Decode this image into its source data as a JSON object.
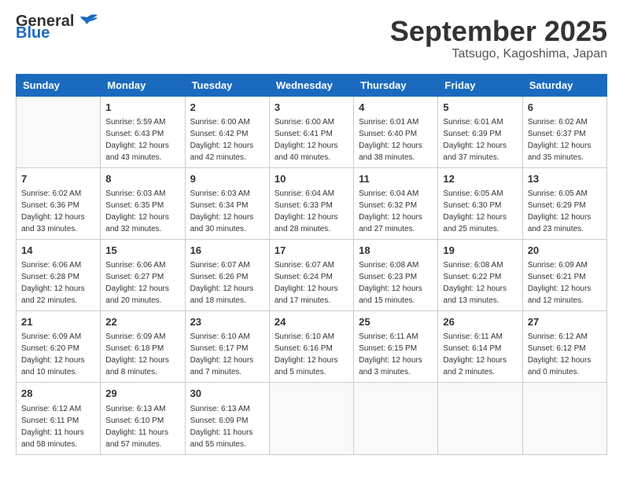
{
  "header": {
    "logo_line1": "General",
    "logo_line2": "Blue",
    "main_title": "September 2025",
    "sub_title": "Tatsugo, Kagoshima, Japan"
  },
  "calendar": {
    "days_of_week": [
      "Sunday",
      "Monday",
      "Tuesday",
      "Wednesday",
      "Thursday",
      "Friday",
      "Saturday"
    ],
    "weeks": [
      [
        {
          "day": "",
          "info": ""
        },
        {
          "day": "1",
          "info": "Sunrise: 5:59 AM\nSunset: 6:43 PM\nDaylight: 12 hours\nand 43 minutes."
        },
        {
          "day": "2",
          "info": "Sunrise: 6:00 AM\nSunset: 6:42 PM\nDaylight: 12 hours\nand 42 minutes."
        },
        {
          "day": "3",
          "info": "Sunrise: 6:00 AM\nSunset: 6:41 PM\nDaylight: 12 hours\nand 40 minutes."
        },
        {
          "day": "4",
          "info": "Sunrise: 6:01 AM\nSunset: 6:40 PM\nDaylight: 12 hours\nand 38 minutes."
        },
        {
          "day": "5",
          "info": "Sunrise: 6:01 AM\nSunset: 6:39 PM\nDaylight: 12 hours\nand 37 minutes."
        },
        {
          "day": "6",
          "info": "Sunrise: 6:02 AM\nSunset: 6:37 PM\nDaylight: 12 hours\nand 35 minutes."
        }
      ],
      [
        {
          "day": "7",
          "info": "Sunrise: 6:02 AM\nSunset: 6:36 PM\nDaylight: 12 hours\nand 33 minutes."
        },
        {
          "day": "8",
          "info": "Sunrise: 6:03 AM\nSunset: 6:35 PM\nDaylight: 12 hours\nand 32 minutes."
        },
        {
          "day": "9",
          "info": "Sunrise: 6:03 AM\nSunset: 6:34 PM\nDaylight: 12 hours\nand 30 minutes."
        },
        {
          "day": "10",
          "info": "Sunrise: 6:04 AM\nSunset: 6:33 PM\nDaylight: 12 hours\nand 28 minutes."
        },
        {
          "day": "11",
          "info": "Sunrise: 6:04 AM\nSunset: 6:32 PM\nDaylight: 12 hours\nand 27 minutes."
        },
        {
          "day": "12",
          "info": "Sunrise: 6:05 AM\nSunset: 6:30 PM\nDaylight: 12 hours\nand 25 minutes."
        },
        {
          "day": "13",
          "info": "Sunrise: 6:05 AM\nSunset: 6:29 PM\nDaylight: 12 hours\nand 23 minutes."
        }
      ],
      [
        {
          "day": "14",
          "info": "Sunrise: 6:06 AM\nSunset: 6:28 PM\nDaylight: 12 hours\nand 22 minutes."
        },
        {
          "day": "15",
          "info": "Sunrise: 6:06 AM\nSunset: 6:27 PM\nDaylight: 12 hours\nand 20 minutes."
        },
        {
          "day": "16",
          "info": "Sunrise: 6:07 AM\nSunset: 6:26 PM\nDaylight: 12 hours\nand 18 minutes."
        },
        {
          "day": "17",
          "info": "Sunrise: 6:07 AM\nSunset: 6:24 PM\nDaylight: 12 hours\nand 17 minutes."
        },
        {
          "day": "18",
          "info": "Sunrise: 6:08 AM\nSunset: 6:23 PM\nDaylight: 12 hours\nand 15 minutes."
        },
        {
          "day": "19",
          "info": "Sunrise: 6:08 AM\nSunset: 6:22 PM\nDaylight: 12 hours\nand 13 minutes."
        },
        {
          "day": "20",
          "info": "Sunrise: 6:09 AM\nSunset: 6:21 PM\nDaylight: 12 hours\nand 12 minutes."
        }
      ],
      [
        {
          "day": "21",
          "info": "Sunrise: 6:09 AM\nSunset: 6:20 PM\nDaylight: 12 hours\nand 10 minutes."
        },
        {
          "day": "22",
          "info": "Sunrise: 6:09 AM\nSunset: 6:18 PM\nDaylight: 12 hours\nand 8 minutes."
        },
        {
          "day": "23",
          "info": "Sunrise: 6:10 AM\nSunset: 6:17 PM\nDaylight: 12 hours\nand 7 minutes."
        },
        {
          "day": "24",
          "info": "Sunrise: 6:10 AM\nSunset: 6:16 PM\nDaylight: 12 hours\nand 5 minutes."
        },
        {
          "day": "25",
          "info": "Sunrise: 6:11 AM\nSunset: 6:15 PM\nDaylight: 12 hours\nand 3 minutes."
        },
        {
          "day": "26",
          "info": "Sunrise: 6:11 AM\nSunset: 6:14 PM\nDaylight: 12 hours\nand 2 minutes."
        },
        {
          "day": "27",
          "info": "Sunrise: 6:12 AM\nSunset: 6:12 PM\nDaylight: 12 hours\nand 0 minutes."
        }
      ],
      [
        {
          "day": "28",
          "info": "Sunrise: 6:12 AM\nSunset: 6:11 PM\nDaylight: 11 hours\nand 58 minutes."
        },
        {
          "day": "29",
          "info": "Sunrise: 6:13 AM\nSunset: 6:10 PM\nDaylight: 11 hours\nand 57 minutes."
        },
        {
          "day": "30",
          "info": "Sunrise: 6:13 AM\nSunset: 6:09 PM\nDaylight: 11 hours\nand 55 minutes."
        },
        {
          "day": "",
          "info": ""
        },
        {
          "day": "",
          "info": ""
        },
        {
          "day": "",
          "info": ""
        },
        {
          "day": "",
          "info": ""
        }
      ]
    ]
  }
}
